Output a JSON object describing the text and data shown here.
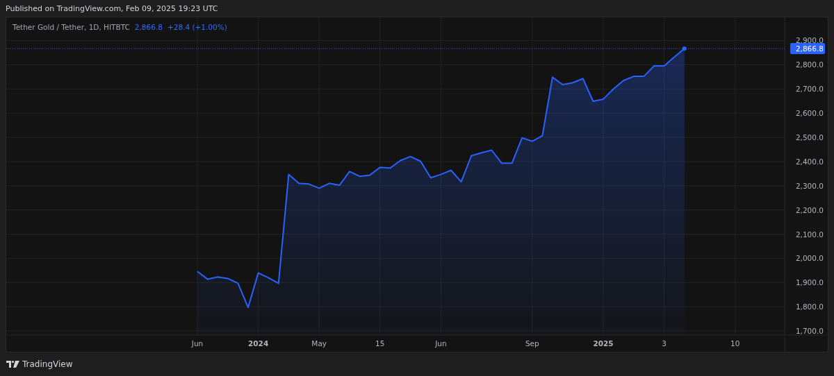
{
  "header": {
    "published": "Published on TradingView.com, Feb 09, 2025 19:23 UTC"
  },
  "legend": {
    "symbol": "Tether Gold / Tether, 1D, HITBTC",
    "price": "2,866.8",
    "change": "+28.4 (+1.00%)"
  },
  "chart": {
    "chart_data": {
      "type": "area",
      "categories": [
        "Jun",
        null,
        null,
        null,
        null,
        null,
        "2024",
        null,
        null,
        null,
        null,
        null,
        "May",
        null,
        null,
        null,
        null,
        null,
        "15",
        null,
        null,
        null,
        null,
        null,
        "Jun",
        null,
        null,
        null,
        null,
        null,
        null,
        null,
        null,
        "Sep",
        null,
        null,
        null,
        null,
        null,
        null,
        "2025",
        null,
        null,
        null,
        null,
        null,
        "3",
        null,
        null,
        null,
        null,
        null,
        null,
        "10"
      ],
      "series": [
        {
          "color": "#2962ff",
          "values": [
            1946,
            1914,
            1923,
            1917,
            1897,
            1797,
            1940,
            1920,
            1897,
            2347,
            2310,
            2307,
            2290,
            2310,
            2302,
            2359,
            2339,
            2344,
            2376,
            2373,
            2404,
            2421,
            2401,
            2333,
            2347,
            2364,
            2316,
            2424,
            2436,
            2447,
            2393,
            2393,
            2498,
            2484,
            2507,
            2749,
            2718,
            2726,
            2743,
            2649,
            2658,
            2700,
            2735,
            2752,
            2752,
            2795,
            2795,
            2832,
            2867,
            null,
            null,
            null,
            null,
            null
          ]
        }
      ],
      "ylim": [
        1683,
        2996
      ],
      "grid": true,
      "ref_lines": [
        {
          "axis": "y",
          "value": 2866.8,
          "color": "#2962ff",
          "label": "2,866.8"
        }
      ],
      "yticks": [
        {
          "value": 2900,
          "label": "2,900.0"
        },
        {
          "value": 2800,
          "label": "2,800.0"
        },
        {
          "value": 2700,
          "label": "2,700.0"
        },
        {
          "value": 2600,
          "label": "2,600.0"
        },
        {
          "value": 2500,
          "label": "2,500.0"
        },
        {
          "value": 2400,
          "label": "2,400.0"
        },
        {
          "value": 2300,
          "label": "2,300.0"
        },
        {
          "value": 2200,
          "label": "2,200.0"
        },
        {
          "value": 2100,
          "label": "2,100.0"
        },
        {
          "value": 2000,
          "label": "2,000.0"
        },
        {
          "value": 1900,
          "label": "1,900.0"
        },
        {
          "value": 1800,
          "label": "1,800.0"
        },
        {
          "value": 1700,
          "label": "1,700.0"
        }
      ]
    }
  },
  "footer": {
    "brand": "TradingView"
  }
}
